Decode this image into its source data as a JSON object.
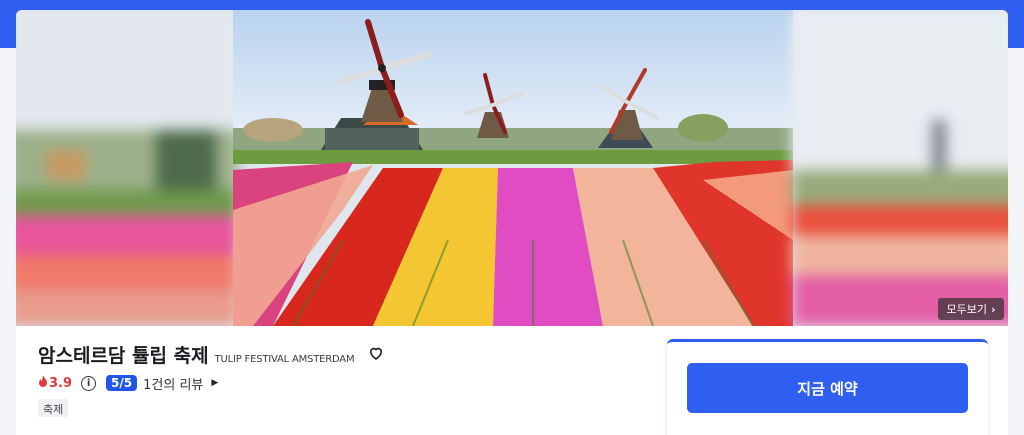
{
  "header": {
    "accent_color": "#2f5ff0"
  },
  "gallery": {
    "main_image": "windmills-and-tulip-fields-photo",
    "more_label": "모두보기"
  },
  "event": {
    "title": "암스테르담 튤립 축제",
    "subtitle": "TULIP FESTIVAL AMSTERDAM",
    "fire_score": "3.9",
    "score_badge": "5/5",
    "review_count": "1건의 리뷰",
    "tag": "축제"
  },
  "booking": {
    "button_label": "지금 예약"
  },
  "icons": {
    "heart": "heart-outline-icon",
    "fire": "fire-icon",
    "info": "info-icon",
    "chevron": "chevron-right-icon"
  }
}
